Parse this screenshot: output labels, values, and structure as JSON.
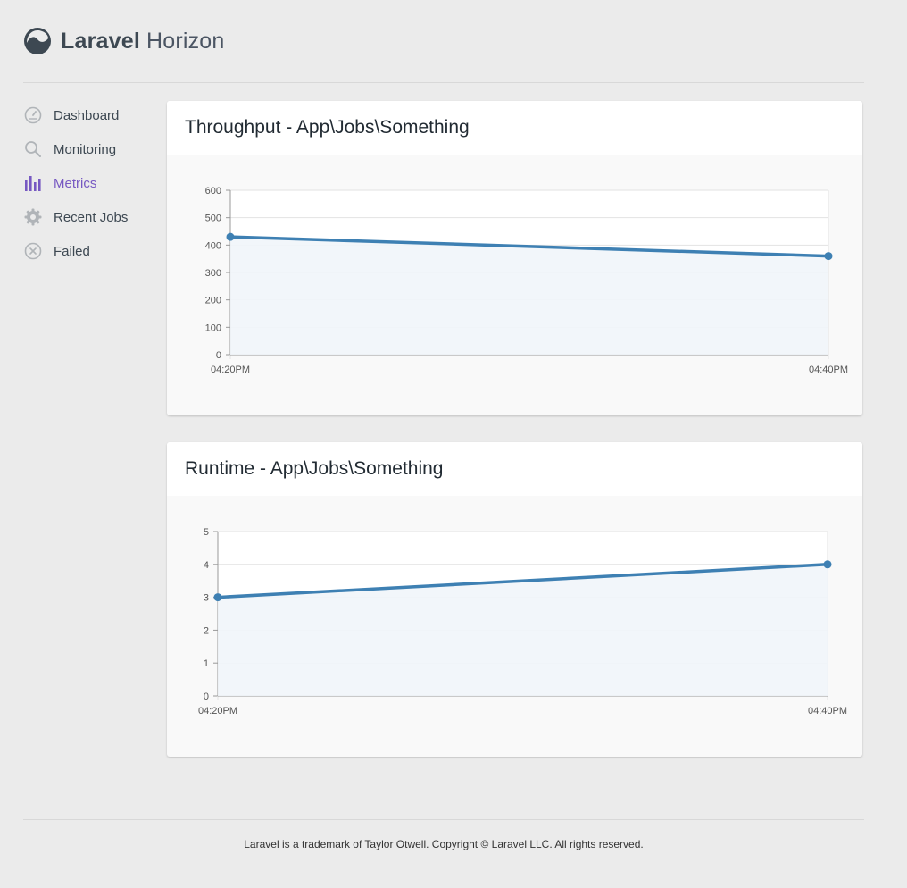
{
  "brand": {
    "name_bold": "Laravel",
    "name_light": "Horizon"
  },
  "sidebar": {
    "items": [
      {
        "label": "Dashboard",
        "icon": "speedometer-icon",
        "active": false
      },
      {
        "label": "Monitoring",
        "icon": "search-icon",
        "active": false
      },
      {
        "label": "Metrics",
        "icon": "bar-chart-icon",
        "active": true
      },
      {
        "label": "Recent Jobs",
        "icon": "gear-icon",
        "active": false
      },
      {
        "label": "Failed",
        "icon": "x-circle-icon",
        "active": false
      }
    ]
  },
  "colors": {
    "accent": "#7759c2",
    "line": "#3e80b3",
    "fill": "#f1f5fa",
    "icon_gray": "#b0b4b8"
  },
  "cards": [
    {
      "title": "Throughput - App\\Jobs\\Something"
    },
    {
      "title": "Runtime - App\\Jobs\\Something"
    }
  ],
  "chart_data": [
    {
      "type": "area",
      "title": "Throughput - App\\Jobs\\Something",
      "x": [
        "04:20PM",
        "04:40PM"
      ],
      "series": [
        {
          "values": [
            430,
            360
          ]
        }
      ],
      "ylim": [
        0,
        600
      ],
      "yticks": [
        0,
        100,
        200,
        300,
        400,
        500,
        600
      ],
      "grid": true
    },
    {
      "type": "area",
      "title": "Runtime - App\\Jobs\\Something",
      "x": [
        "04:20PM",
        "04:40PM"
      ],
      "series": [
        {
          "values": [
            3,
            4
          ]
        }
      ],
      "ylim": [
        0,
        5
      ],
      "yticks": [
        0,
        1,
        2,
        3,
        4,
        5
      ],
      "grid": true
    }
  ],
  "footer": {
    "text": "Laravel is a trademark of Taylor Otwell. Copyright © Laravel LLC. All rights reserved."
  }
}
